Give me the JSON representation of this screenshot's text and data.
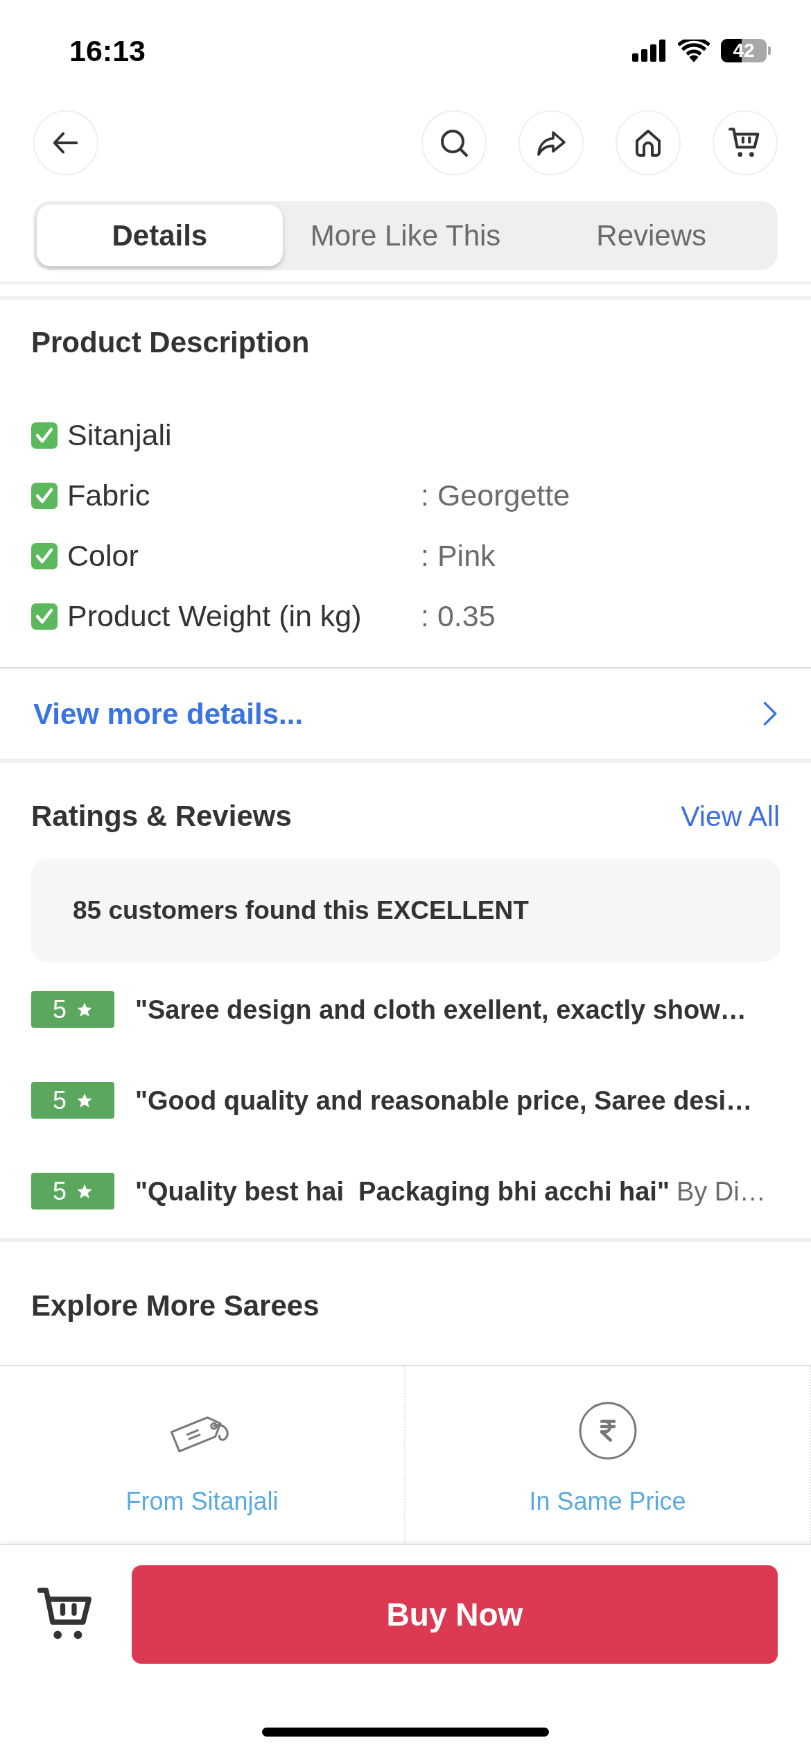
{
  "status_bar": {
    "time": "16:13",
    "battery": "42"
  },
  "tabs": [
    {
      "label": "Details",
      "selected": true
    },
    {
      "label": "More Like This",
      "selected": false
    },
    {
      "label": "Reviews",
      "selected": false
    }
  ],
  "product_description": {
    "title": "Product Description",
    "attributes": [
      {
        "label": "Sitanjali"
      },
      {
        "label": "Fabric",
        "value": ": Georgette"
      },
      {
        "label": "Color",
        "value": ": Pink"
      },
      {
        "label": "Product Weight (in kg)",
        "value": ": 0.35"
      }
    ],
    "view_more": "View more details..."
  },
  "ratings_reviews": {
    "title": "Ratings & Reviews",
    "view_all": "View All",
    "summary": "85 customers found this EXCELLENT",
    "reviews": [
      {
        "rating": "5",
        "text": "\"Saree design and cloth exellent, exactly show…"
      },
      {
        "rating": "5",
        "text": "\"Good quality and reasonable price, Saree desi…"
      },
      {
        "rating": "5",
        "text": "\"Quality best hai  Packaging bhi acchi hai\"",
        "author": "By Di…"
      }
    ]
  },
  "explore": {
    "title": "Explore More Sarees",
    "options": [
      {
        "kind": "tag",
        "label": "From Sitanjali"
      },
      {
        "kind": "price",
        "label": "In Same Price"
      }
    ]
  },
  "buy_button": "Buy Now"
}
